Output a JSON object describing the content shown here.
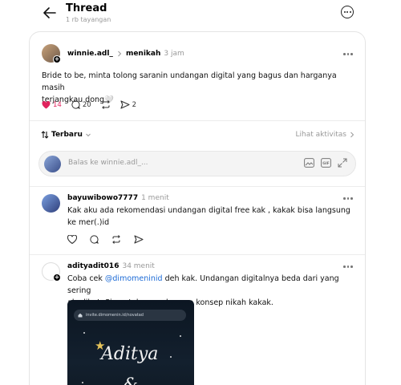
{
  "header": {
    "title": "Thread",
    "subtitle": "1 rb tayangan"
  },
  "post": {
    "username": "winnie.adl_",
    "reply_to": "menikah",
    "time": "3 jam",
    "text_line1": "Bride to be, minta tolong saranin undangan digital yang bagus dan harganya masih",
    "text_line2": "terjangkau dong🤍",
    "likes": "14",
    "comments": "20",
    "shares": "2"
  },
  "sort": {
    "label": "Terbaru",
    "activity_link": "Lihat aktivitas"
  },
  "reply_box": {
    "placeholder": "Balas ke winnie.adl_..."
  },
  "comments": [
    {
      "username": "bayuwibowo7777",
      "time": "1 menit",
      "line1": "Kak aku ada rekomendasi undangan digital free kak , kakak bisa langsung",
      "line2": "ke mer(.)id"
    },
    {
      "username": "adityadit016",
      "time": "34 menit",
      "line1_pre": "Coba cek ",
      "mention": "@dimomeninid",
      "line1_post": " deh kak. Undangan digitalnya beda dari yang sering",
      "line2": "aku lihat. Siapa tahu cocok sama konsep nikah kakak.",
      "image": {
        "url": "invite.dimomenin.id/novatad",
        "script_line1": "Aditya",
        "script_line2": "&"
      }
    }
  ],
  "colors": {
    "like": "#e0245e",
    "link": "#1d6bd6",
    "muted": "#999999"
  }
}
